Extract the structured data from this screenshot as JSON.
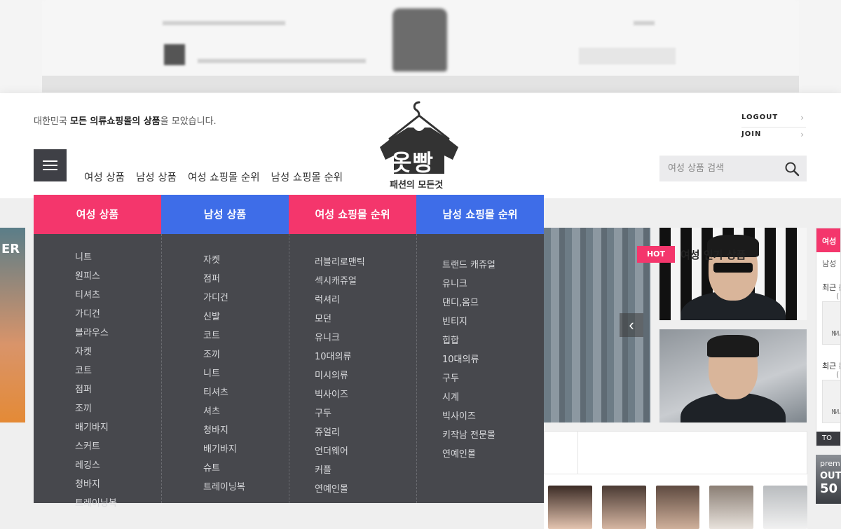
{
  "header": {
    "tagline_prefix": "대한민국 ",
    "tagline_bold": "모든 의류쇼핑몰의 상품",
    "tagline_suffix": "을 모았습니다.",
    "logo_title": "옷빵",
    "logo_subtitle": "패션의 모든것",
    "nav": [
      "여성 상품",
      "남성 상품",
      "여성 쇼핑몰 순위",
      "남성 쇼핑몰 순위"
    ],
    "util_links": [
      "LOGOUT",
      "JOIN"
    ],
    "search_placeholder": "여성 상품 검색"
  },
  "mega_menu": {
    "columns": [
      {
        "title": "여성 상품",
        "color": "#f4366c",
        "items": [
          "니트",
          "원피스",
          "티셔츠",
          "가디건",
          "블라우스",
          "자켓",
          "코트",
          "점퍼",
          "조끼",
          "배기바지",
          "스커트",
          "레깅스",
          "청바지",
          "트레이닝복"
        ]
      },
      {
        "title": "남성 상품",
        "color": "#3e6de8",
        "items": [
          "자켓",
          "점퍼",
          "가디건",
          "신발",
          "코트",
          "조끼",
          "니트",
          "티셔츠",
          "셔츠",
          "청바지",
          "배기바지",
          "슈트",
          "트레이닝복"
        ]
      },
      {
        "title": "여성 쇼핑몰 순위",
        "color": "#f4366c",
        "items": [
          "러블리로맨틱",
          "섹시캐쥬얼",
          "럭셔리",
          "모던",
          "유니크",
          "10대의류",
          "미시의류",
          "빅사이즈",
          "구두",
          "쥬얼리",
          "언더웨어",
          "커플",
          "연예인몰"
        ]
      },
      {
        "title": "남성 쇼핑몰 순위",
        "color": "#3e6de8",
        "items": [
          "트랜드 캐쥬얼",
          "유니크",
          "댄디,옴므",
          "빈티지",
          "힙합",
          "10대의류",
          "구두",
          "시계",
          "빅사이즈",
          "키작남 전문몰",
          "연예인몰"
        ]
      }
    ]
  },
  "content": {
    "left_banner_text": "ER",
    "hot_badge": "HOT",
    "hot_title": "여성 인기 상품",
    "side_panel": {
      "tab_label": "여성",
      "tab2_label": "남성",
      "recent_1": "최근 본",
      "recent_1_paren": "(",
      "no_image_1": "N",
      "no_image_2": "IMA",
      "recent_2": "최근 본",
      "recent_2_paren": "(",
      "no_image_3": "N",
      "no_image_4": "IMA",
      "bottom": "TO"
    },
    "promo_text_1": "prem",
    "promo_text_2": "OUT",
    "promo_text_3": "50"
  },
  "colors": {
    "accent_pink": "#f4366c",
    "accent_blue": "#3e6de8",
    "menu_bg": "#47484d",
    "dark_button": "#3f4046"
  }
}
